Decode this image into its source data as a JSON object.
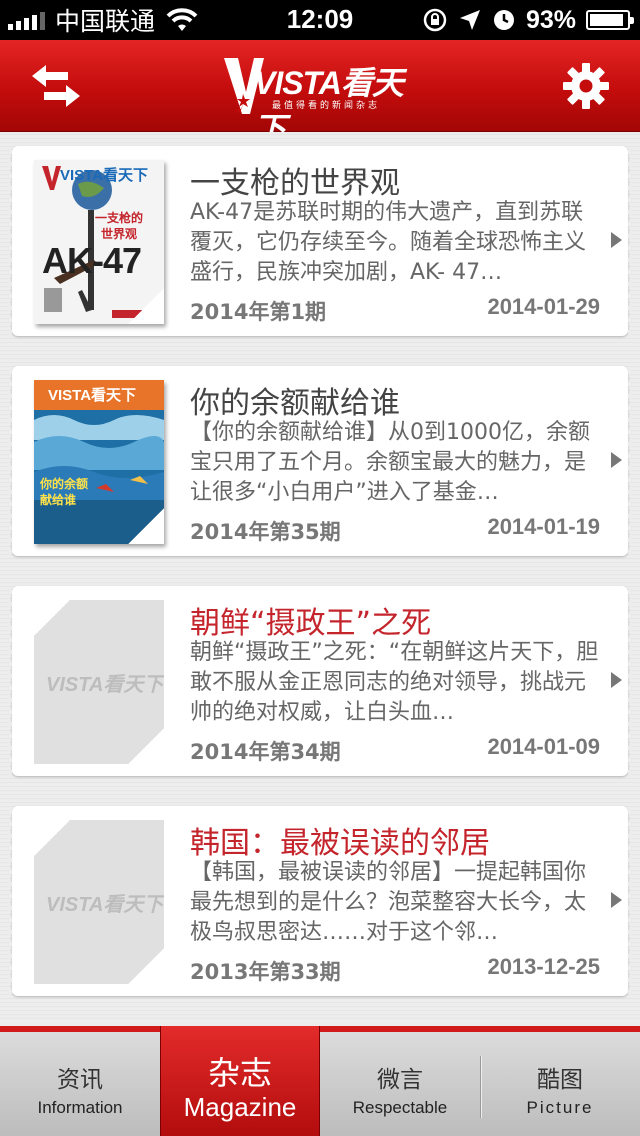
{
  "status_bar": {
    "carrier": "中国联通",
    "time": "12:09",
    "battery": "93%",
    "battery_level": 0.93,
    "signal_bars": 4
  },
  "nav": {
    "logo_text": "VISTA看天下",
    "logo_subtitle": "最值得看的新闻杂志",
    "left_icon": "swap-arrows-icon",
    "right_icon": "gear-icon",
    "accent": "#c40c0c"
  },
  "articles": [
    {
      "title": "一支枪的世界观",
      "title_color": "dark",
      "summary": "AK-47是苏联时期的伟大遗产，直到苏联覆灭，它仍存续至今。随着全球恐怖主义盛行，民族冲突加剧，AK- 47…",
      "issue": "2014年第1期",
      "date": "2014-01-29",
      "cover": {
        "masthead": "VISTA看天下",
        "headline": "一支枪的世界观",
        "big_text": "AK-47"
      }
    },
    {
      "title": "你的余额献给谁",
      "title_color": "dark",
      "summary": "【你的余额献给谁】从0到1000亿，余额宝只用了五个月。余额宝最大的魅力，是让很多“小白用户”进入了基金…",
      "issue": "2014年第35期",
      "date": "2014-01-19",
      "cover": {
        "masthead": "VISTA看天下",
        "headline": "你的余额献给谁"
      }
    },
    {
      "title": "朝鲜“摄政王”之死",
      "title_color": "red",
      "summary": "朝鲜“摄政王”之死：“在朝鲜这片天下，胆敢不服从金正恩同志的绝对领导，挑战元帅的绝对权威，让白头血…",
      "issue": "2014年第34期",
      "date": "2014-01-09",
      "cover": {
        "masthead": "VISTA看天下"
      }
    },
    {
      "title": "韩国：最被误读的邻居",
      "title_color": "red",
      "summary": "【韩国，最被误读的邻居】一提起韩国你最先想到的是什么？泡菜整容大长今，太极鸟叔思密达……对于这个邻…",
      "issue": "2013年第33期",
      "date": "2013-12-25",
      "cover": {
        "masthead": "VISTA看天下"
      }
    }
  ],
  "tabs": [
    {
      "zh": "资讯",
      "en": "Information"
    },
    {
      "zh": "杂志",
      "en": "Magazine"
    },
    {
      "zh": "微言",
      "en": "Respectable"
    },
    {
      "zh": "酷图",
      "en": "Picture"
    }
  ]
}
